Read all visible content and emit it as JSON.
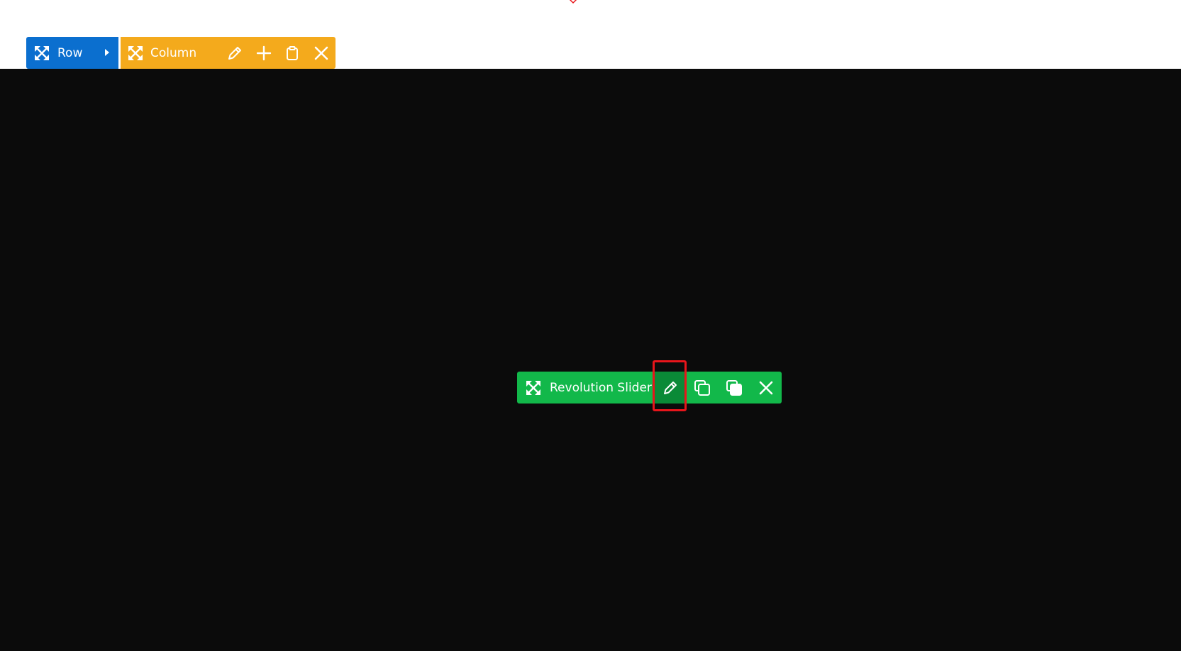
{
  "toolbar_row": {
    "label": "Row",
    "color": "#0b6fcf",
    "icons": [
      "move-icon",
      "caret-right-icon"
    ]
  },
  "toolbar_column": {
    "label": "Column",
    "color": "#f4aa1c",
    "icons": [
      "move-icon",
      "pencil-icon",
      "plus-icon",
      "clipboard-icon",
      "close-icon"
    ]
  },
  "toolbar_element": {
    "label": "Revolution Slider",
    "color": "#12b84a",
    "active_color": "#0a8a37",
    "icons": [
      "move-icon",
      "pencil-icon",
      "clone-icon",
      "copy-icon",
      "close-icon"
    ]
  },
  "stage": {
    "background": "#0b0b0b"
  },
  "highlight": {
    "color": "#e8151b",
    "target": "element-edit-button"
  }
}
